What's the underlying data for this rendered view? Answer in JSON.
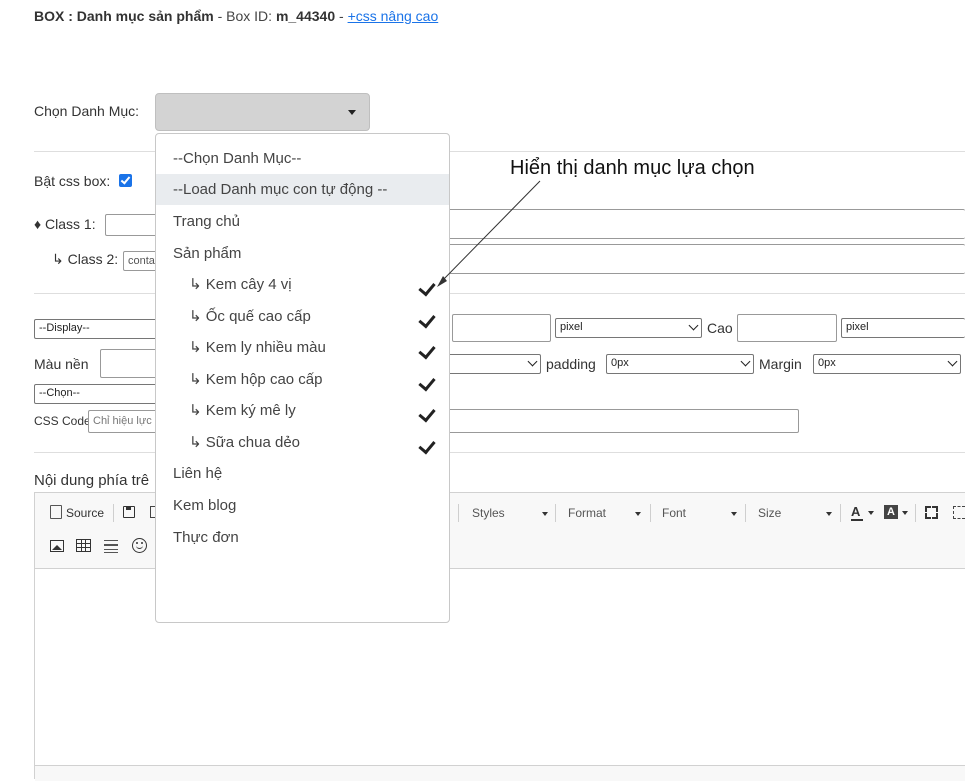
{
  "header": {
    "title": "BOX : Danh mục sản phẩm",
    "sep1": " - Box ID: ",
    "box_id": "m_44340",
    "sep2": " - ",
    "css_link": "+css nâng cao"
  },
  "category": {
    "label": "Chọn Danh Mục:",
    "selected": ""
  },
  "dropdown": {
    "items": [
      {
        "label": "--Chọn Danh Mục--",
        "level": 0,
        "checked": false,
        "highlighted": false
      },
      {
        "label": "--Load Danh mục con tự động --",
        "level": 0,
        "checked": false,
        "highlighted": true
      },
      {
        "label": "Trang chủ",
        "level": 0,
        "checked": false,
        "highlighted": false
      },
      {
        "label": "Sản phẩm",
        "level": 0,
        "checked": false,
        "highlighted": false
      },
      {
        "label": "↳ Kem cây 4 vị",
        "level": 1,
        "checked": true,
        "highlighted": false
      },
      {
        "label": "↳ Ốc quế cao cấp",
        "level": 1,
        "checked": true,
        "highlighted": false
      },
      {
        "label": "↳ Kem ly nhiều màu",
        "level": 1,
        "checked": true,
        "highlighted": false
      },
      {
        "label": "↳ Kem hộp cao cấp",
        "level": 1,
        "checked": true,
        "highlighted": false
      },
      {
        "label": "↳ Kem ký mê ly",
        "level": 1,
        "checked": true,
        "highlighted": false
      },
      {
        "label": "↳ Sữa chua dẻo",
        "level": 1,
        "checked": true,
        "highlighted": false
      },
      {
        "label": "Liên hệ",
        "level": 0,
        "checked": false,
        "highlighted": false
      },
      {
        "label": "Kem blog",
        "level": 0,
        "checked": false,
        "highlighted": false
      },
      {
        "label": "Thực đơn",
        "level": 0,
        "checked": false,
        "highlighted": false
      }
    ]
  },
  "annotation": {
    "text": "Hiển thị danh mục lựa chọn"
  },
  "css_box": {
    "label": "Bật css box:",
    "checked": true,
    "class1_label": "♦ Class 1:",
    "class2_label": "↳ Class 2:",
    "class2_value": "contai"
  },
  "style_row": {
    "display_value": "--Display--",
    "width_unit": "pixel",
    "height_label": "Cao",
    "height_unit": "pixel",
    "bg_label": "Màu nền",
    "padding_label": "padding",
    "padding_value": "0px",
    "margin_label": "Margin",
    "margin_value": "0px",
    "choose_value": "--Chọn--",
    "css_code_label": "CSS Code",
    "css_code_placeholder": "Chỉ hiệu lực"
  },
  "editor": {
    "content_label": "Nội dung phía trê",
    "source_label": "Source",
    "styles_label": "Styles",
    "format_label": "Format",
    "font_label": "Font",
    "size_label": "Size"
  }
}
